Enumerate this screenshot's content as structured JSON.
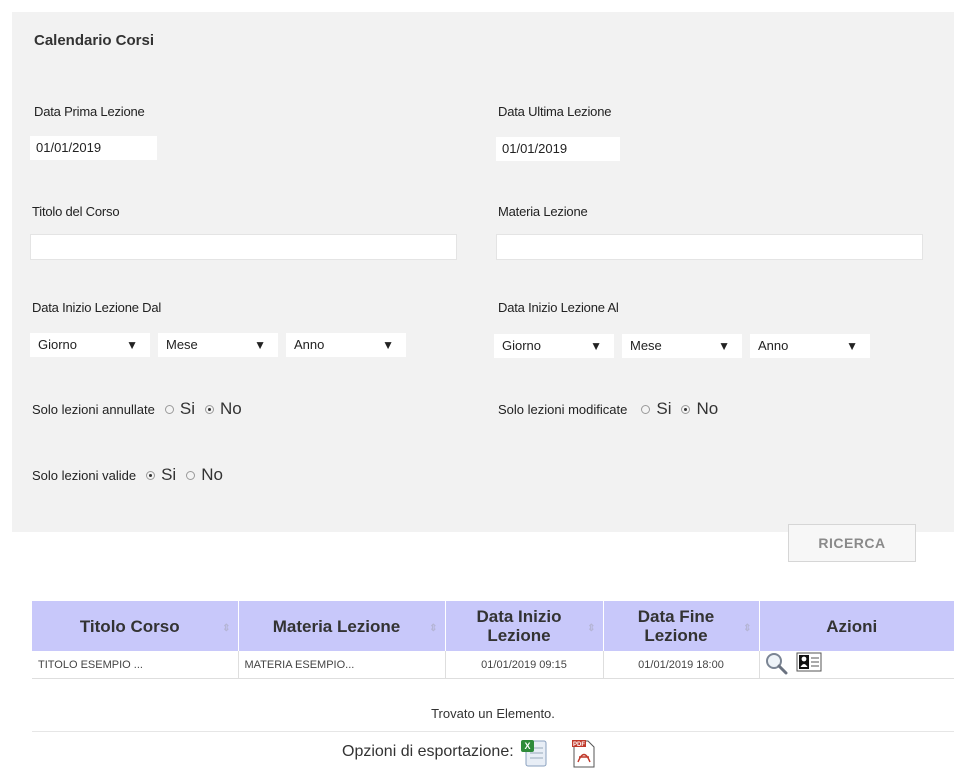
{
  "form": {
    "title": "Calendario Corsi",
    "data_prima_label": "Data Prima Lezione",
    "data_prima_value": "01/01/2019",
    "data_ultima_label": "Data Ultima Lezione",
    "data_ultima_value": "01/01/2019",
    "titolo_label": "Titolo del Corso",
    "materia_label": "Materia Lezione",
    "inizio_dal_label": "Data Inizio Lezione Dal",
    "inizio_al_label": "Data Inizio Lezione Al",
    "dal": {
      "giorno": "Giorno",
      "mese": "Mese",
      "anno": "Anno"
    },
    "al": {
      "giorno": "Giorno",
      "mese": "Mese",
      "anno": "Anno"
    },
    "annullate_label": "Solo lezioni annullate",
    "modificate_label": "Solo lezioni modificate",
    "valide_label": "Solo lezioni valide",
    "opt_si": "Si",
    "opt_no": "No",
    "search_button": "RICERCA"
  },
  "table": {
    "headers": [
      "Titolo Corso",
      "Materia Lezione",
      "Data Inizio Lezione",
      "Data Fine Lezione",
      "Azioni"
    ],
    "rows": [
      {
        "titolo": "TITOLO ESEMPIO ...",
        "materia": "MATERIA ESEMPIO...",
        "inizio": "01/01/2019 09:15",
        "fine": "01/01/2019 18:00"
      }
    ],
    "found_text": "Trovato un Elemento.",
    "export_label": "Opzioni di esportazione:"
  },
  "icons": {
    "view": "magnifier-icon",
    "detail": "contact-card-icon",
    "excel": "excel-export-icon",
    "pdf": "pdf-export-icon"
  }
}
